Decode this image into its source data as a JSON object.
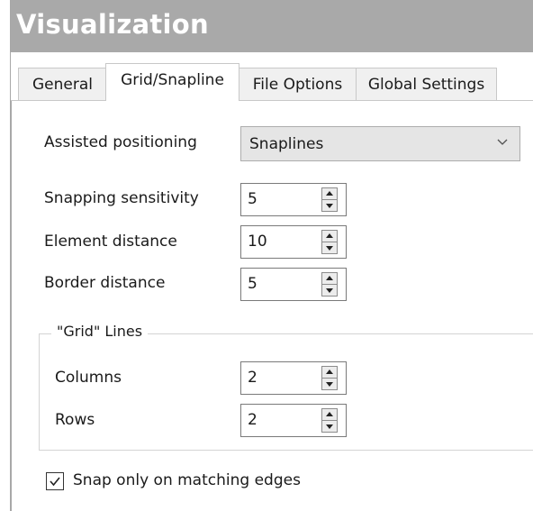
{
  "window": {
    "title": "Visualization"
  },
  "tabs": [
    {
      "label": "General"
    },
    {
      "label": "Grid/Snapline",
      "active": true
    },
    {
      "label": "File Options"
    },
    {
      "label": "Global Settings"
    }
  ],
  "assisted_positioning": {
    "label": "Assisted positioning",
    "value": "Snaplines"
  },
  "snapping_sensitivity": {
    "label": "Snapping sensitivity",
    "value": "5"
  },
  "element_distance": {
    "label": "Element distance",
    "value": "10"
  },
  "border_distance": {
    "label": "Border distance",
    "value": "5"
  },
  "grid_lines": {
    "legend": "\"Grid\" Lines",
    "columns": {
      "label": "Columns",
      "value": "2"
    },
    "rows": {
      "label": "Rows",
      "value": "2"
    }
  },
  "snap_matching_edges": {
    "label": "Snap only on matching edges",
    "checked": true
  },
  "icons": {
    "dropdown": "chevron-down-icon",
    "spin_up": "arrow-up-icon",
    "spin_down": "arrow-down-icon",
    "checkmark": "checkmark-icon"
  },
  "colors": {
    "titlebar": "#a9a9a9",
    "title_text": "#ffffff",
    "tab_inactive": "#f0f0f0",
    "combo_bg": "#e5e5e5"
  }
}
